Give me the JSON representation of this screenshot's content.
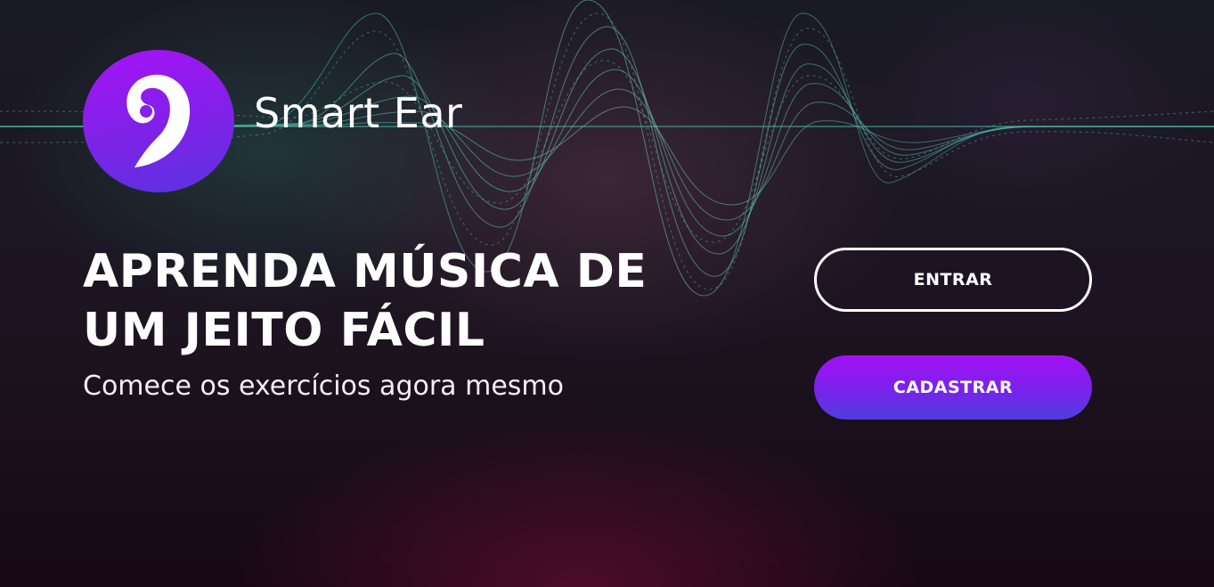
{
  "brand": {
    "name": "Smart Ear",
    "logo_icon": "ear-icon"
  },
  "hero": {
    "headline_line1": "APRENDA MÚSICA DE",
    "headline_line2": "UM JEITO FÁCIL",
    "subtitle": "Comece os exercícios agora mesmo"
  },
  "actions": {
    "login_label": "ENTRAR",
    "register_label": "CADASTRAR"
  },
  "colors": {
    "accent_purple": "#a614f5",
    "accent_indigo": "#4f3ee0",
    "background": "#1a1420",
    "text": "#ffffff"
  }
}
